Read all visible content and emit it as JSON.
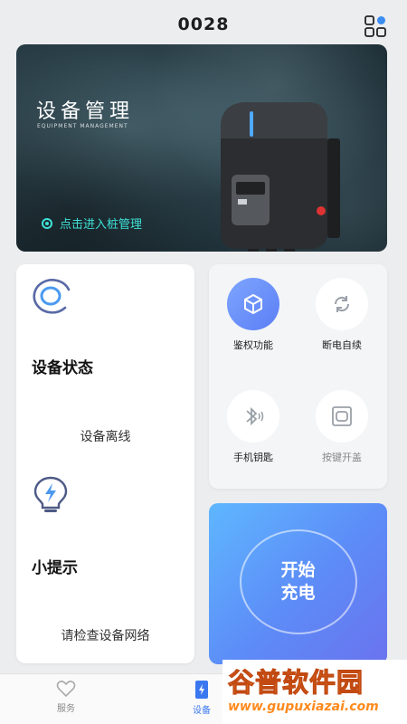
{
  "header": {
    "title": "0028",
    "menu_icon": "grid-icon"
  },
  "banner": {
    "title": "设备管理",
    "subtitle": "EQUIPMENT MANAGEMENT",
    "link_label": "点击进入桩管理",
    "accent": "#3fe0d7"
  },
  "status_card": {
    "status_title": "设备状态",
    "status_value": "设备离线",
    "tip_title": "小提示",
    "tip_value": "请检查设备网络"
  },
  "functions": [
    {
      "label": "鉴权功能",
      "icon": "cube-icon",
      "active": true
    },
    {
      "label": "断电自续",
      "icon": "refresh-icon",
      "active": false
    },
    {
      "label": "手机钥匙",
      "icon": "bluetooth-icon",
      "active": false
    },
    {
      "label": "按键开盖",
      "icon": "lid-icon",
      "active": false,
      "dimmed": true
    }
  ],
  "charge": {
    "line1": "开始",
    "line2": "充电"
  },
  "tabbar": {
    "tabs": [
      {
        "label": "服务",
        "icon": "heart-icon",
        "active": false
      },
      {
        "label": "设备",
        "icon": "device-icon",
        "active": true
      }
    ]
  },
  "watermark": {
    "text": "谷普软件园",
    "url": "www.gupuxiazai.com"
  },
  "colors": {
    "primary": "#3b78f0",
    "charge_start": "#5eb7ff",
    "charge_end": "#6a73ee"
  }
}
